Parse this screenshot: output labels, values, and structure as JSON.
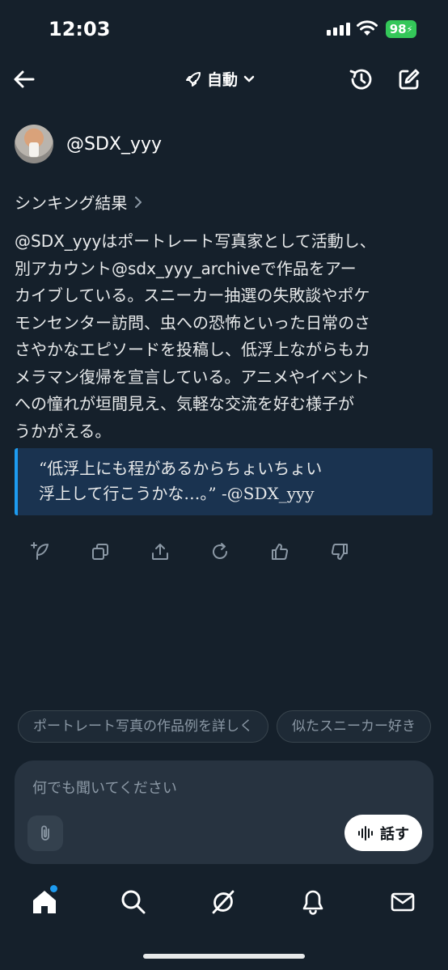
{
  "status": {
    "time": "12:03",
    "battery": "98"
  },
  "nav": {
    "mode_label": "自動"
  },
  "user": {
    "handle": "@SDX_yyy"
  },
  "thinking_label": "シンキング結果",
  "body_lines": [
    "@SDX_yyyはポートレート写真家として活動し、",
    "別アカウント@sdx_yyy_archiveで作品をアー",
    "カイブしている。スニーカー抽選の失敗談やポケ",
    "モンセンター訪問、虫への恐怖といった日常のさ",
    "さやかなエピソードを投稿し、低浮上ながらもカ",
    "メラマン復帰を宣言している。アニメやイベント",
    "への憧れが垣間見え、気軽な交流を好む様子が",
    "うかがえる。"
  ],
  "quote_lines": [
    "“低浮上にも程があるからちょいちょい",
    "浮上して行こうかな…。” -@SDX_yyy"
  ],
  "actions": [
    "sparkle-edit",
    "copy",
    "share",
    "regenerate",
    "like",
    "dislike"
  ],
  "suggestions": [
    "ポートレート写真の作品例を詳しく",
    "似たスニーカー好き"
  ],
  "input": {
    "placeholder": "何でも聞いてください",
    "talk_label": "話す"
  },
  "colors": {
    "background": "#15202b",
    "accent": "#1d9bf0",
    "quote_bg": "#1a3350",
    "battery": "#34c759"
  }
}
